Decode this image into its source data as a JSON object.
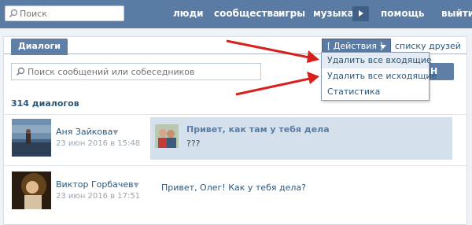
{
  "topbar": {
    "search_placeholder": "Поиск",
    "nav": [
      "люди",
      "сообщества",
      "игры",
      "музыка",
      "помощь",
      "выйти"
    ]
  },
  "tabs": {
    "dialogs_label": "Диалоги",
    "actions_label": "[ Действия ]",
    "friends_link": "списку друзей"
  },
  "search": {
    "placeholder": "Поиск сообщений или собеседников",
    "write_button": "Н"
  },
  "dialogs_count": "314 диалогов",
  "dropdown": {
    "items": [
      "Удалить все входящие",
      "Удалить все исходящие",
      "Статистика"
    ]
  },
  "dialogs": [
    {
      "name": "Аня Зайкова",
      "caret": "▼",
      "date": "23 июн 2016 в 15:48",
      "title": "Привет, как там у тебя дела",
      "body": "???",
      "unread": true
    },
    {
      "name": "Виктор Горбачев",
      "caret": "▼",
      "date": "23 июн 2016 в 17:51",
      "message": "Привет, Олег! Как у тебя дела?"
    }
  ],
  "colors": {
    "topbar": "#5a7ba3",
    "accent": "#5f7fa6",
    "link": "#2b587a",
    "unread_bg": "#d4e0ec",
    "arrow": "#d8201e"
  }
}
